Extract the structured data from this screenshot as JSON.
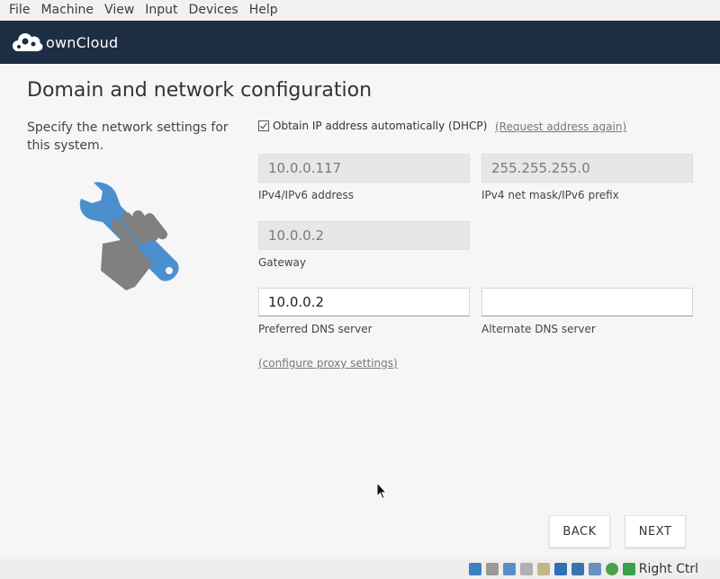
{
  "menu": {
    "items": [
      "File",
      "Machine",
      "View",
      "Input",
      "Devices",
      "Help"
    ]
  },
  "brand": {
    "name": "ownCloud",
    "header_color": "#1d2d44"
  },
  "page": {
    "title": "Domain and network configuration",
    "intro": "Specify the network settings for this system."
  },
  "dhcp": {
    "label": "Obtain IP address automatically (DHCP)",
    "checked": true,
    "request_again_link": "(Request address again)"
  },
  "fields": {
    "ip_address": {
      "value": "10.0.0.117",
      "label": "IPv4/IPv6 address"
    },
    "netmask": {
      "value": "255.255.255.0",
      "label": "IPv4 net mask/IPv6 prefix"
    },
    "gateway": {
      "value": "10.0.0.2",
      "label": "Gateway"
    },
    "preferred_dns": {
      "value": "10.0.0.2",
      "label": "Preferred DNS server"
    },
    "alternate_dns": {
      "value": "",
      "label": "Alternate DNS server"
    }
  },
  "proxy_link": "(configure proxy settings)",
  "buttons": {
    "back": "BACK",
    "next": "NEXT"
  },
  "statusbar": {
    "icons": [
      "hard-disk-icon",
      "optical-drive-icon",
      "network-icon",
      "usb-icon",
      "shared-folder-icon",
      "display-icon",
      "video-capture-icon",
      "cpu-icon",
      "mouse-integration-icon",
      "keyboard-capture-icon"
    ],
    "host_key": "Right Ctrl"
  },
  "colors": {
    "wrench_blue": "#4b8fcf",
    "hand_gray": "#808080"
  }
}
